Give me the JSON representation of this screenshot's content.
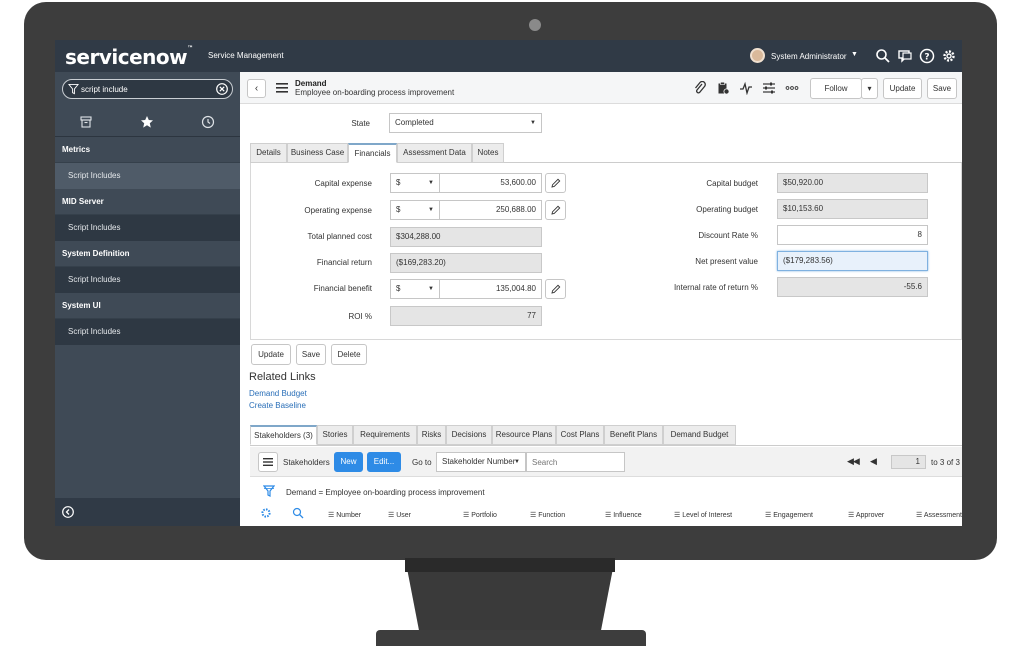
{
  "brand": {
    "logo": "servicenow",
    "app_name": "Service Management"
  },
  "user": {
    "name": "System Administrator"
  },
  "sidebar": {
    "search_value": "script include",
    "groups": [
      {
        "title": "Metrics",
        "item": "Script Includes"
      },
      {
        "title": "MID Server",
        "item": "Script Includes"
      },
      {
        "title": "System Definition",
        "item": "Script Includes"
      },
      {
        "title": "System UI",
        "item": "Script Includes"
      }
    ]
  },
  "header": {
    "record_type": "Demand",
    "record_name": "Employee on-boarding process improvement",
    "follow_label": "Follow",
    "update_label": "Update",
    "save_label": "Save"
  },
  "form": {
    "state_label": "State",
    "state_value": "Completed",
    "tabs": [
      "Details",
      "Business Case",
      "Financials",
      "Assessment Data",
      "Notes"
    ],
    "active_tab": "Financials",
    "left_fields": {
      "capital_expense": {
        "label": "Capital expense",
        "currency": "$",
        "value": "53,600.00"
      },
      "operating_expense": {
        "label": "Operating expense",
        "currency": "$",
        "value": "250,688.00"
      },
      "total_planned_cost": {
        "label": "Total planned cost",
        "value": "$304,288.00"
      },
      "financial_return": {
        "label": "Financial return",
        "value": "($169,283.20)"
      },
      "financial_benefit": {
        "label": "Financial benefit",
        "currency": "$",
        "value": "135,004.80"
      },
      "roi": {
        "label": "ROI %",
        "value": "77"
      }
    },
    "right_fields": {
      "capital_budget": {
        "label": "Capital budget",
        "value": "$50,920.00"
      },
      "operating_budget": {
        "label": "Operating budget",
        "value": "$10,153.60"
      },
      "discount_rate": {
        "label": "Discount Rate %",
        "value": "8"
      },
      "npv": {
        "label": "Net present value",
        "value": "($179,283.56)"
      },
      "irr": {
        "label": "Internal rate of return %",
        "value": "-55.6"
      }
    },
    "actions": {
      "update": "Update",
      "save": "Save",
      "delete": "Delete"
    }
  },
  "related_links": {
    "title": "Related Links",
    "links": [
      "Demand Budget",
      "Create Baseline"
    ]
  },
  "related_lists": {
    "tabs": [
      "Stakeholders (3)",
      "Stories",
      "Requirements",
      "Risks",
      "Decisions",
      "Resource Plans",
      "Cost Plans",
      "Benefit Plans",
      "Demand Budget"
    ],
    "list_title": "Stakeholders",
    "new_label": "New",
    "edit_label": "Edit...",
    "goto_label": "Go to",
    "goto_field": "Stakeholder Number",
    "search_placeholder": "Search",
    "page_value": "1",
    "page_total": "to 3 of 3",
    "filter_text": "Demand = Employee on-boarding process improvement",
    "columns": [
      "Number",
      "User",
      "Portfolio",
      "Function",
      "Influence",
      "Level of Interest",
      "Engagement",
      "Approver",
      "Assessment"
    ]
  },
  "colors": {
    "topbar": "#303a46",
    "sidebar": "#3f4a56",
    "primary": "#2e8be6",
    "link": "#2a6fb8"
  }
}
